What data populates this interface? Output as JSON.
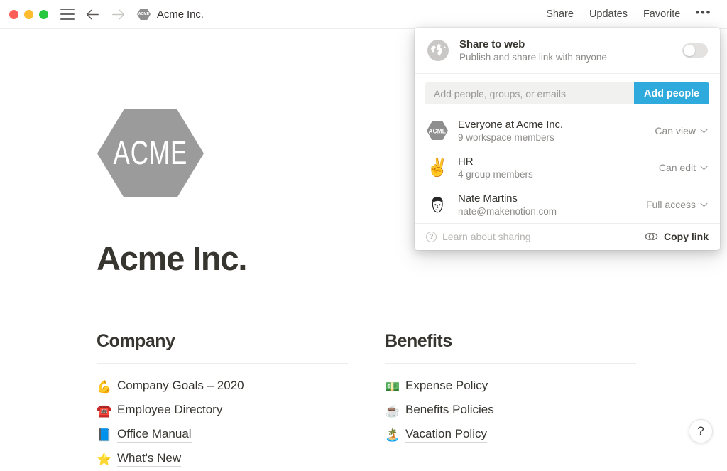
{
  "titlebar": {
    "window_controls": [
      "close",
      "minimize",
      "maximize"
    ],
    "menu_icon": "hamburger-icon",
    "back_icon": "arrow-left-icon",
    "forward_icon": "arrow-right-icon",
    "doc_icon_text": "ACME",
    "doc_title": "Acme Inc.",
    "actions": [
      {
        "label": "Share"
      },
      {
        "label": "Updates"
      },
      {
        "label": "Favorite"
      }
    ],
    "more_label": "•••"
  },
  "page": {
    "logo_text": "ACME",
    "title": "Acme Inc.",
    "columns": [
      {
        "heading": "Company",
        "links": [
          {
            "emoji": "💪",
            "emoji_name": "flexed-biceps-icon",
            "label": "Company Goals – 2020"
          },
          {
            "emoji": "☎️",
            "emoji_name": "telephone-icon",
            "label": "Employee Directory"
          },
          {
            "emoji": "📘",
            "emoji_name": "blue-book-icon",
            "label": "Office Manual"
          },
          {
            "emoji": "⭐",
            "emoji_name": "star-icon",
            "label": "What's New"
          }
        ]
      },
      {
        "heading": "Benefits",
        "links": [
          {
            "emoji": "💵",
            "emoji_name": "banknote-icon",
            "label": "Expense Policy"
          },
          {
            "emoji": "☕",
            "emoji_name": "coffee-icon",
            "label": "Benefits Policies"
          },
          {
            "emoji": "🏝️",
            "emoji_name": "island-icon",
            "label": "Vacation Policy"
          }
        ]
      }
    ],
    "help_label": "?"
  },
  "share_popup": {
    "web": {
      "icon": "globe-icon",
      "title": "Share to web",
      "subtitle": "Publish and share link with anyone",
      "toggle_on": false
    },
    "invite": {
      "placeholder": "Add people, groups, or emails",
      "value": "",
      "button_label": "Add people"
    },
    "people": [
      {
        "avatar_type": "hex",
        "avatar_text": "ACME",
        "name": "Everyone at Acme Inc.",
        "detail": "9 workspace members",
        "permission": "Can view"
      },
      {
        "avatar_type": "emoji",
        "avatar_text": "✌️",
        "avatar_name": "victory-hand-icon",
        "name": "HR",
        "detail": "4 group members",
        "permission": "Can edit"
      },
      {
        "avatar_type": "face",
        "avatar_text": "",
        "avatar_name": "user-face-avatar",
        "name": "Nate Martins",
        "detail": "nate@makenotion.com",
        "permission": "Full access"
      }
    ],
    "footer": {
      "learn_label": "Learn about sharing",
      "copy_label": "Copy link"
    }
  },
  "colors": {
    "accent_blue": "#2eaadc",
    "text_primary": "#37352f",
    "text_muted": "#8b8a87",
    "logo_gray": "#9b9b9b"
  }
}
